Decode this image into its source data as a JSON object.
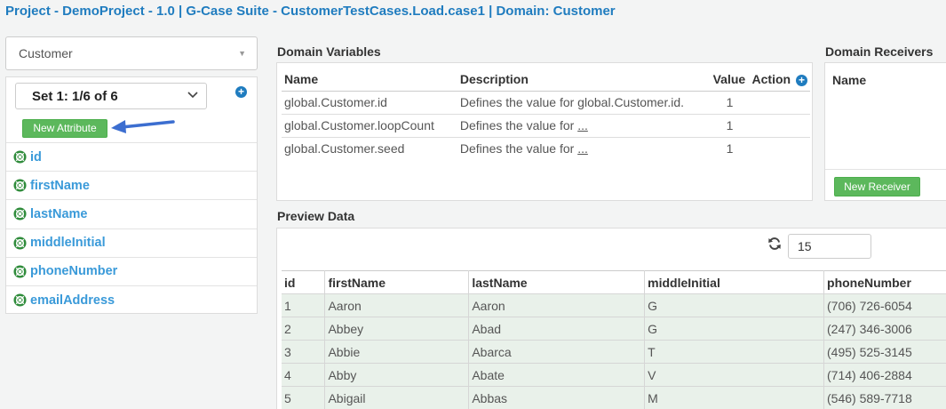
{
  "header": {
    "title": "Project - DemoProject - 1.0 | G-Case Suite - CustomerTestCases.Load.case1 | Domain: Customer"
  },
  "domain_select": {
    "value": "Customer",
    "icon": "caret-down-icon"
  },
  "attributes_panel": {
    "set_select": "Set 1: 1/6 of 6",
    "add_icon": "plus-circle-icon",
    "new_attribute_label": "New Attribute",
    "items": [
      {
        "label": "id"
      },
      {
        "label": "firstName"
      },
      {
        "label": "lastName"
      },
      {
        "label": "middleInitial"
      },
      {
        "label": "phoneNumber"
      },
      {
        "label": "emailAddress"
      }
    ]
  },
  "domain_variables": {
    "title": "Domain Variables",
    "columns": [
      "Name",
      "Description",
      "Value",
      "Action"
    ],
    "rows": [
      {
        "name": "global.Customer.id",
        "description": "Defines the value for global.Customer.id.",
        "link": "",
        "value": "1"
      },
      {
        "name": "global.Customer.loopCount",
        "description": "Defines the value for",
        "link": "...",
        "value": "1"
      },
      {
        "name": "global.Customer.seed",
        "description": "Defines the value for",
        "link": "...",
        "value": "1"
      }
    ]
  },
  "domain_receivers": {
    "title": "Domain Receivers",
    "column": "Name",
    "new_receiver_label": "New Receiver"
  },
  "preview_data": {
    "title": "Preview Data",
    "row_count": "15",
    "refresh_icon": "refresh-icon",
    "columns": [
      "id",
      "firstName",
      "lastName",
      "middleInitial",
      "phoneNumber"
    ],
    "rows": [
      [
        "1",
        "Aaron",
        "Aaron",
        "G",
        "(706) 726-6054"
      ],
      [
        "2",
        "Abbey",
        "Abad",
        "G",
        "(247) 346-3006"
      ],
      [
        "3",
        "Abbie",
        "Abarca",
        "T",
        "(495) 525-3145"
      ],
      [
        "4",
        "Abby",
        "Abate",
        "V",
        "(714) 406-2884"
      ],
      [
        "5",
        "Abigail",
        "Abbas",
        "M",
        "(546) 589-7718"
      ]
    ]
  },
  "colors": {
    "accent_blue": "#1f7cbf",
    "link_blue": "#3a9ad9",
    "green_button": "#5cb85c",
    "row_bg": "#e9f1ea"
  }
}
